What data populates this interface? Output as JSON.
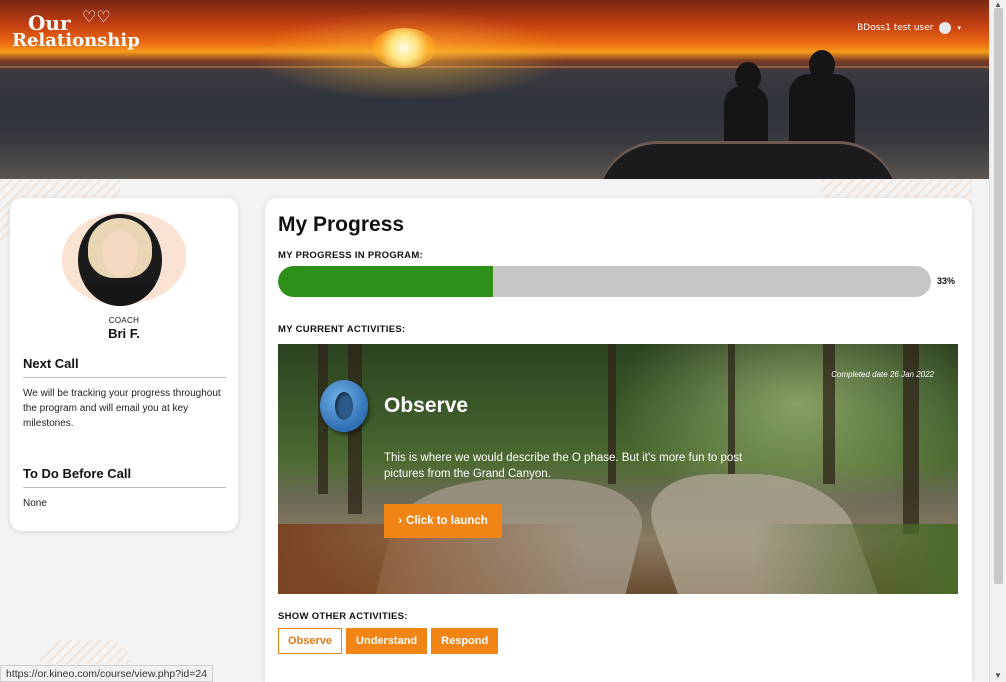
{
  "header": {
    "logo_line1": "Our",
    "logo_line2": "Relationship",
    "logo_hearts": "♡♡",
    "user_name": "BDoss1 test user",
    "caret": "▾"
  },
  "coach": {
    "role": "COACH",
    "name": "Bri F."
  },
  "sidebar": {
    "next_call_heading": "Next Call",
    "next_call_text": "We will be tracking your progress throughout the program and will email you at key milestones.",
    "todo_heading": "To Do Before Call",
    "todo_text": "None"
  },
  "main": {
    "title": "My Progress",
    "progress_label": "MY PROGRESS IN PROGRAM:",
    "progress_value": 33,
    "progress_text": "33%",
    "activities_label": "MY CURRENT ACTIVITIES:",
    "activity": {
      "completed": "Completed date 26 Jan 2022",
      "title": "Observe",
      "description": "This is where we would describe the O phase.  But it's more fun to post pictures from the Grand Canyon.",
      "launch_icon": "›",
      "launch_label": "Click to launch"
    },
    "other_label": "SHOW OTHER ACTIVITIES:",
    "other_activities": [
      "Observe",
      "Understand",
      "Respond"
    ]
  },
  "status_bar": {
    "url": "https://or.kineo.com/course/view.php?id=24"
  },
  "colors": {
    "accent": "#f08515",
    "progress": "#2e8f18",
    "track": "#c6c6c6"
  }
}
